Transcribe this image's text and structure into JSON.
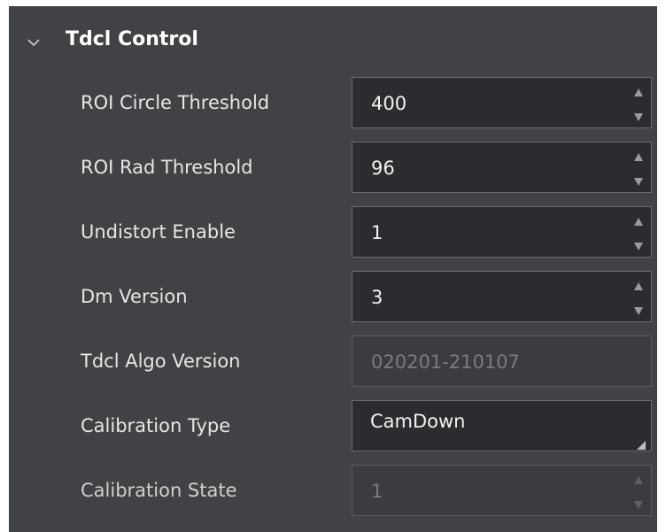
{
  "section": {
    "title": "Tdcl Control",
    "expanded": true
  },
  "properties": [
    {
      "label": "ROI Circle Threshold",
      "value": "400",
      "control": "spinbox",
      "enabled": true
    },
    {
      "label": "ROI Rad Threshold",
      "value": "96",
      "control": "spinbox",
      "enabled": true
    },
    {
      "label": "Undistort Enable",
      "value": "1",
      "control": "spinbox",
      "enabled": true
    },
    {
      "label": "Dm Version",
      "value": "3",
      "control": "spinbox",
      "enabled": true
    },
    {
      "label": "Tdcl Algo Version",
      "value": "020201-210107",
      "control": "text",
      "enabled": false
    },
    {
      "label": "Calibration Type",
      "value": "CamDown",
      "control": "combobox",
      "enabled": true
    },
    {
      "label": "Calibration State",
      "value": "1",
      "control": "spinbox",
      "enabled": false
    }
  ],
  "colors": {
    "panel_background": "#414245",
    "field_background": "#2b2c2f",
    "field_border": "#6a6b6e",
    "text": "#e6e6e6",
    "disabled_text": "#7a7b7e"
  }
}
